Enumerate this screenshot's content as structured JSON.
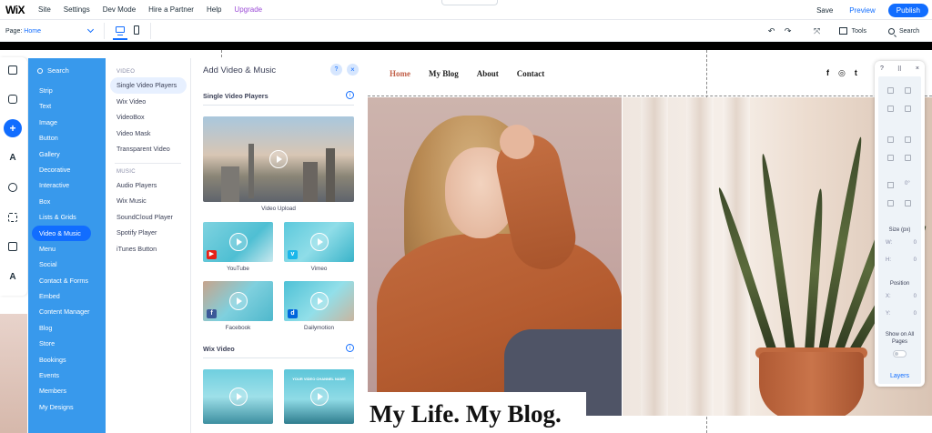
{
  "topbar": {
    "logo": "WiX",
    "menu": [
      "Site",
      "Settings",
      "Dev Mode",
      "Hire a Partner",
      "Help",
      "Upgrade"
    ],
    "save": "Save",
    "preview": "Preview",
    "publish": "Publish"
  },
  "secondbar": {
    "page_label": "Page:",
    "page_value": "Home",
    "undo_icon": "undo-icon",
    "redo_icon": "redo-icon",
    "tools": "Tools",
    "search": "Search"
  },
  "rail": {
    "icons": [
      "menus-pages-icon",
      "background-icon",
      "add-icon",
      "theme-icon",
      "app-market-icon",
      "add-apps-icon",
      "media-icon",
      "blog-icon"
    ],
    "active": "add-icon",
    "accent": "#116dff"
  },
  "categories": {
    "search": "Search",
    "items": [
      "Strip",
      "Text",
      "Image",
      "Button",
      "Gallery",
      "Decorative",
      "Interactive",
      "Box",
      "Lists & Grids",
      "Video & Music",
      "Menu",
      "Social",
      "Contact & Forms",
      "Embed",
      "Content Manager",
      "Blog",
      "Store",
      "Bookings",
      "Events",
      "Members",
      "My Designs"
    ],
    "active": "Video & Music",
    "bg_color": "#3899ec"
  },
  "subcategories": {
    "video_heading": "VIDEO",
    "video_items": [
      "Single Video Players",
      "Wix Video",
      "VideoBox",
      "Video Mask",
      "Transparent Video"
    ],
    "music_heading": "MUSIC",
    "music_items": [
      "Audio Players",
      "Wix Music",
      "SoundCloud Player",
      "Spotify Player",
      "iTunes Button"
    ],
    "active": "Single Video Players"
  },
  "media_panel": {
    "title": "Add Video & Music",
    "help": "?",
    "close": "×",
    "section1": "Single Video Players",
    "section2": "Wix Video",
    "info": "i",
    "thumbs": [
      {
        "caption": "Video Upload"
      },
      {
        "caption": "YouTube",
        "badge": "▶"
      },
      {
        "caption": "Vimeo",
        "badge": "v"
      },
      {
        "caption": "Facebook",
        "badge": "f"
      },
      {
        "caption": "Dailymotion",
        "badge": "d"
      }
    ],
    "wix_thumb2_text": "YOUR VIDEO CHANNEL NAME"
  },
  "site": {
    "nav": [
      "Home",
      "My Blog",
      "About",
      "Contact"
    ],
    "active_nav": "Home",
    "social": [
      "f",
      "◎",
      "t"
    ],
    "title": "My Life. My Blog."
  },
  "tool_panel": {
    "help": "?",
    "drag": "⠿",
    "close": "×",
    "rotate_value": "0°",
    "size_label": "Size (px)",
    "w_label": "W:",
    "w_value": "0",
    "h_label": "H:",
    "h_value": "0",
    "position_label": "Position",
    "x_label": "X:",
    "x_value": "0",
    "y_label": "Y:",
    "y_value": "0",
    "show_all_pages": "Show on All Pages",
    "layers": "Layers"
  }
}
